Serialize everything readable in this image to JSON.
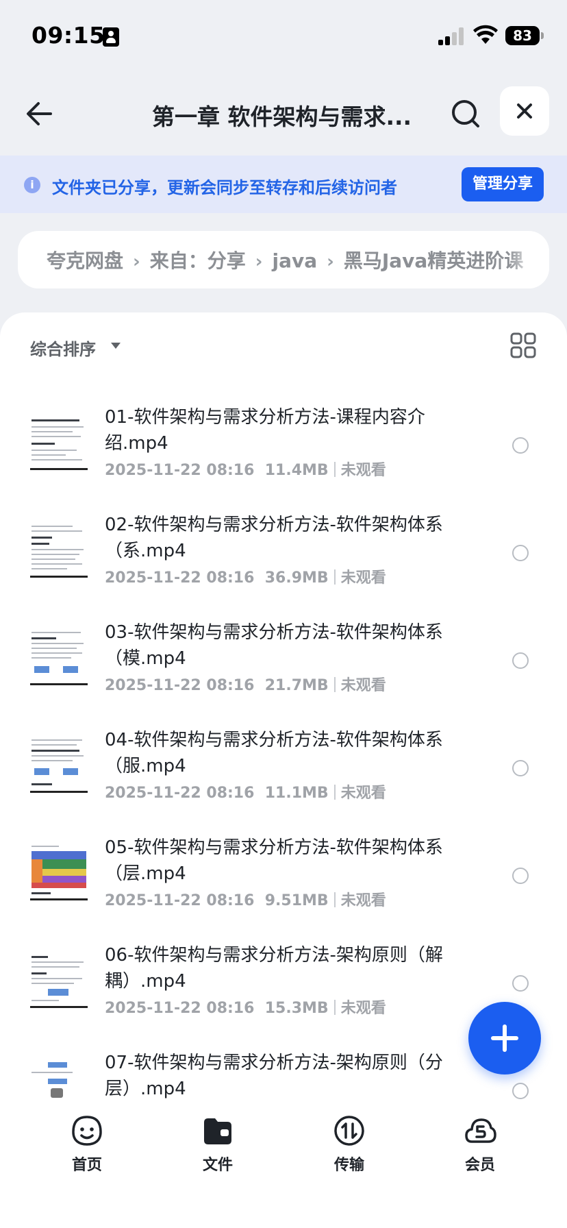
{
  "status_bar": {
    "time": "09:15",
    "battery": "83"
  },
  "header": {
    "title": "第一章 软件架构与需求..."
  },
  "share_banner": {
    "info": "i",
    "text": "文件夹已分享，更新会同步至转存和后续访问者",
    "manage_label": "管理分享"
  },
  "breadcrumb": [
    "夸克网盘",
    "来自：分享",
    "java",
    "黑马Java精英进阶课"
  ],
  "sort": {
    "label": "综合排序"
  },
  "files": [
    {
      "name": "01-软件架构与需求分析方法-课程内容介绍.mp4",
      "date": "2025-11-22 08:16",
      "size": "11.4MB",
      "status": "未观看"
    },
    {
      "name": "02-软件架构与需求分析方法-软件架构体系（系.mp4",
      "date": "2025-11-22 08:16",
      "size": "36.9MB",
      "status": "未观看"
    },
    {
      "name": "03-软件架构与需求分析方法-软件架构体系（模.mp4",
      "date": "2025-11-22 08:16",
      "size": "21.7MB",
      "status": "未观看"
    },
    {
      "name": "04-软件架构与需求分析方法-软件架构体系（服.mp4",
      "date": "2025-11-22 08:16",
      "size": "11.1MB",
      "status": "未观看"
    },
    {
      "name": "05-软件架构与需求分析方法-软件架构体系（层.mp4",
      "date": "2025-11-22 08:16",
      "size": "9.51MB",
      "status": "未观看"
    },
    {
      "name": "06-软件架构与需求分析方法-架构原则（解耦）.mp4",
      "date": "2025-11-22 08:16",
      "size": "15.3MB",
      "status": "未观看"
    },
    {
      "name": "07-软件架构与需求分析方法-架构原则（分层）.mp4",
      "date": "",
      "size": "",
      "status": ""
    }
  ],
  "nav": [
    {
      "label": "首页",
      "icon": "home-face-icon"
    },
    {
      "label": "文件",
      "icon": "folder-icon"
    },
    {
      "label": "传输",
      "icon": "transfer-icon"
    },
    {
      "label": "会员",
      "icon": "vip-cloud-icon"
    }
  ],
  "colors": {
    "accent": "#1b5ef0",
    "banner_bg": "#e3e8fa",
    "banner_text": "#2364e6"
  }
}
